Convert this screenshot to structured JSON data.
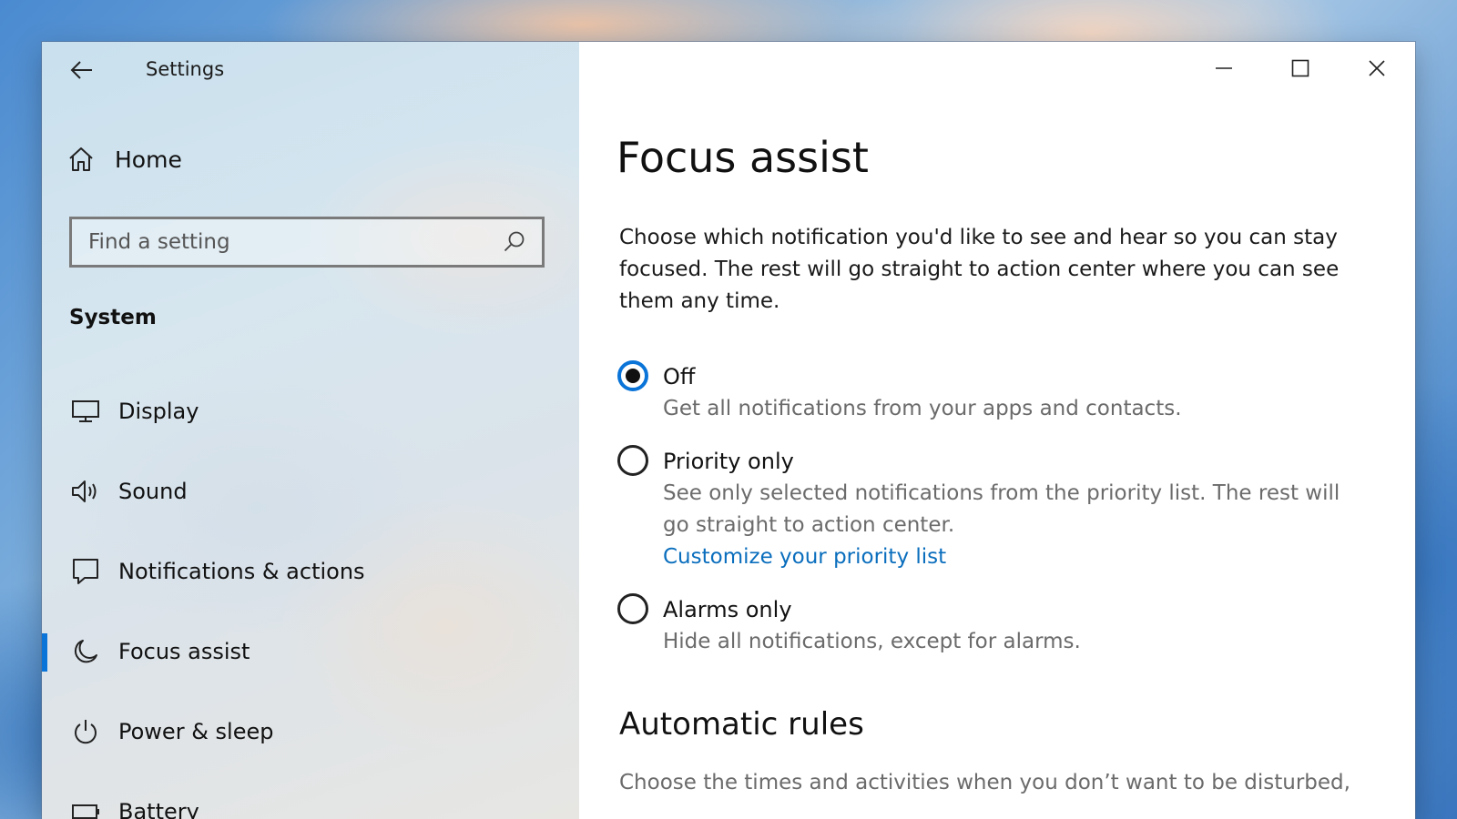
{
  "titlebar": {
    "back": "back-arrow-icon",
    "title": "Settings"
  },
  "sidebar": {
    "home_label": "Home",
    "search": {
      "placeholder": "Find a setting"
    },
    "section_label": "System",
    "items": [
      {
        "label": "Display",
        "icon": "monitor-icon",
        "active": false
      },
      {
        "label": "Sound",
        "icon": "speaker-icon",
        "active": false
      },
      {
        "label": "Notifications & actions",
        "icon": "notification-icon",
        "active": false
      },
      {
        "label": "Focus assist",
        "icon": "moon-icon",
        "active": true
      },
      {
        "label": "Power & sleep",
        "icon": "power-icon",
        "active": false
      },
      {
        "label": "Battery",
        "icon": "battery-icon",
        "active": false
      }
    ]
  },
  "window_controls": [
    "minimize-icon",
    "maximize-icon",
    "close-icon"
  ],
  "main": {
    "title": "Focus assist",
    "intro": "Choose which notification you'd like to see and hear so you can stay focused. The rest will go straight to action center where you can see them any time.",
    "options": [
      {
        "label": "Off",
        "description": "Get all notifications from your apps and contacts.",
        "checked": true
      },
      {
        "label": "Priority only",
        "description": "See only selected notifications from the priority list. The rest will go straight to action center.",
        "link": "Customize your priority list",
        "checked": false
      },
      {
        "label": "Alarms only",
        "description": "Hide all notifications, except for alarms.",
        "checked": false
      }
    ],
    "automatic_rules": {
      "heading": "Automatic rules",
      "description": "Choose the times and activities when you don’t want to be disturbed,"
    }
  },
  "colors": {
    "accent": "#0a74d8",
    "link": "#0a6ebd",
    "secondary_text": "#6b6b6b"
  }
}
